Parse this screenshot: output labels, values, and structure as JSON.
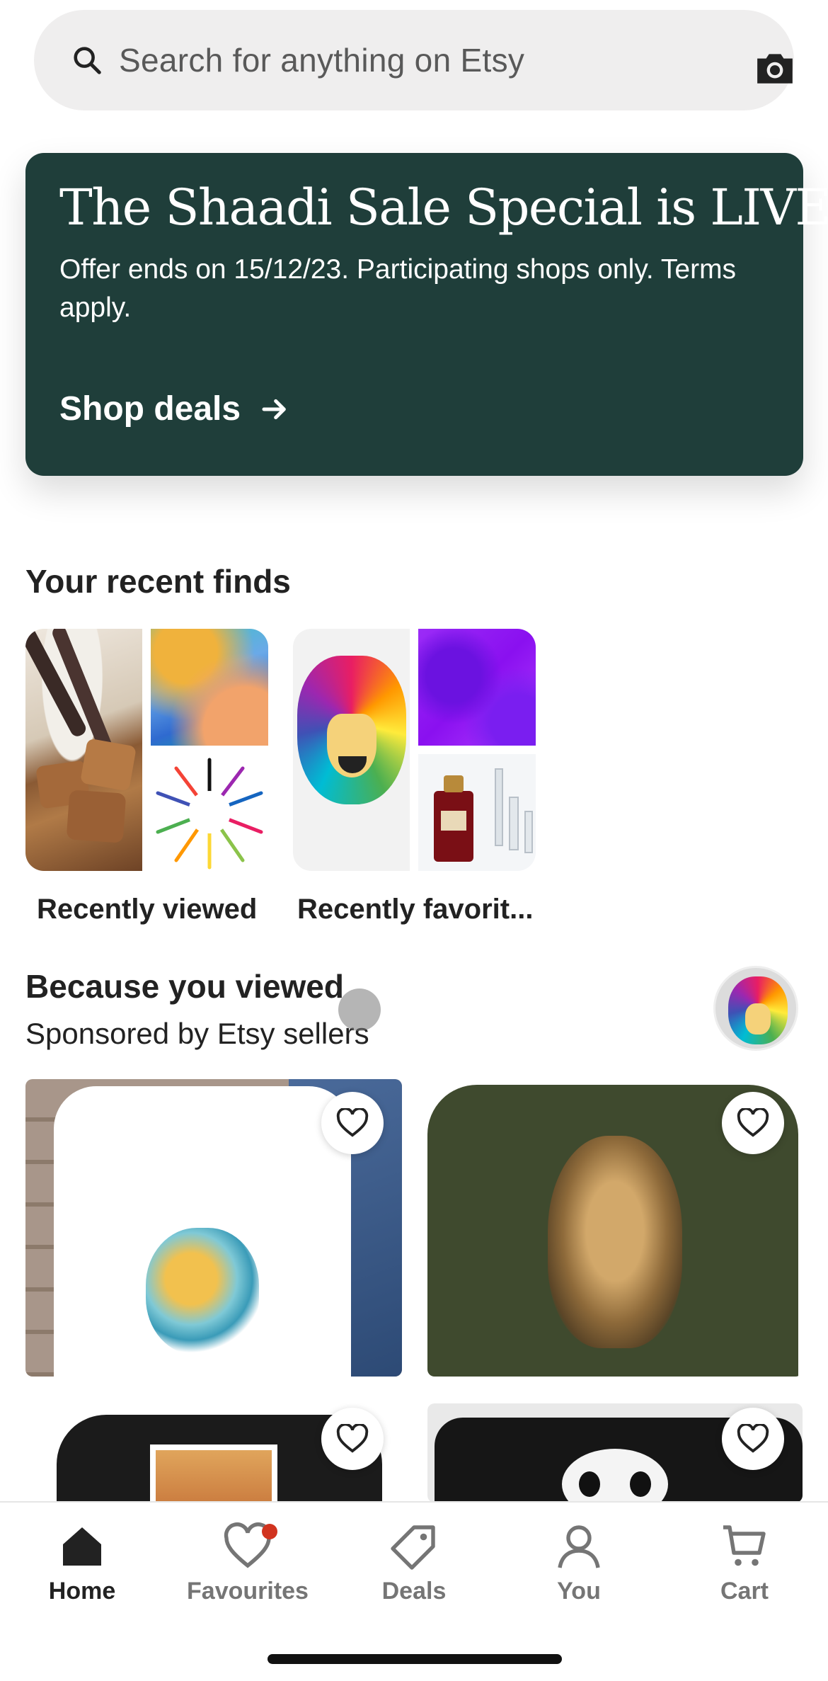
{
  "search": {
    "placeholder": "Search for anything on Etsy",
    "search_icon": "search-icon",
    "camera_icon": "camera-icon"
  },
  "banner": {
    "title": "The Shaadi Sale Special is LIVE!",
    "subtitle": "Offer ends on 15/12/23. Participating shops only. Terms apply.",
    "cta": "Shop deals",
    "cta_icon": "arrow-right-icon",
    "background": "#1f3e3a"
  },
  "recent_finds": {
    "title": "Your recent finds",
    "collections": [
      {
        "label": "Recently viewed"
      },
      {
        "label": "Recently favorit..."
      }
    ]
  },
  "because_viewed": {
    "title": "Because you viewed",
    "subtitle": "Sponsored by Etsy sellers"
  },
  "nav": {
    "items": [
      {
        "label": "Home",
        "icon": "home-icon",
        "active": true
      },
      {
        "label": "Favourites",
        "icon": "heart-icon",
        "badge": true
      },
      {
        "label": "Deals",
        "icon": "tag-icon"
      },
      {
        "label": "You",
        "icon": "user-icon"
      },
      {
        "label": "Cart",
        "icon": "cart-icon"
      }
    ],
    "badge_color": "#d1331f"
  }
}
